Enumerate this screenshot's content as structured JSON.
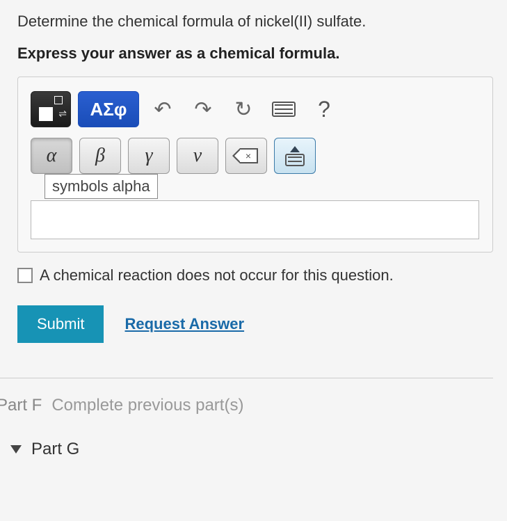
{
  "question": "Determine the chemical formula of nickel(II) sulfate.",
  "instruction": "Express your answer as a chemical formula.",
  "toolbar": {
    "greek_palette_label": "ΑΣφ",
    "undo_icon": "↶",
    "redo_icon": "↷",
    "reset_icon": "↻",
    "help_label": "?"
  },
  "greek": {
    "alpha": "α",
    "beta": "β",
    "gamma": "γ",
    "nu": "ν",
    "tooltip": "symbols alpha"
  },
  "backspace_x": "×",
  "checkbox_label": "A chemical reaction does not occur for this question.",
  "actions": {
    "submit": "Submit",
    "request": "Request Answer"
  },
  "partF": {
    "label": "Part F",
    "status": "Complete previous part(s)"
  },
  "partG": {
    "label": "Part G"
  }
}
